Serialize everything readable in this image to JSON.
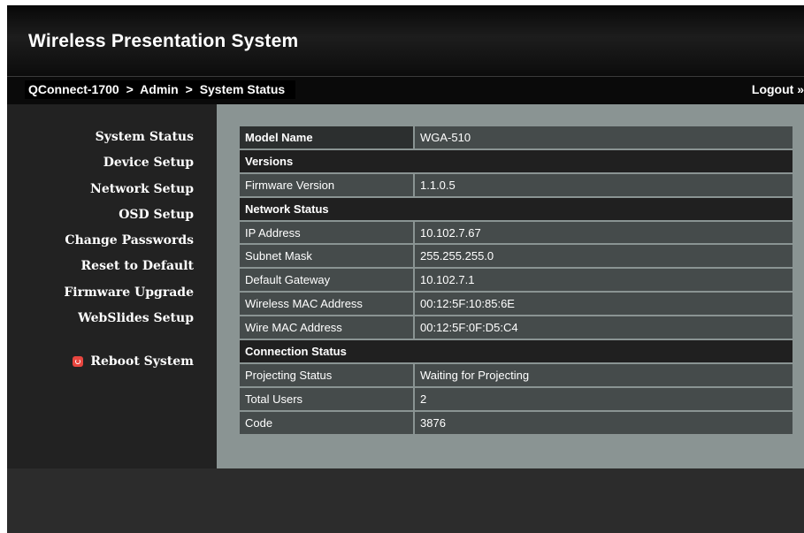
{
  "app": {
    "title": "Wireless Presentation System"
  },
  "breadcrumb": {
    "device": "QConnect-1700",
    "section": "Admin",
    "page": "System Status",
    "separator": ">"
  },
  "header": {
    "logout_label": "Logout »"
  },
  "sidebar": {
    "items": [
      {
        "label": "System Status"
      },
      {
        "label": "Device Setup"
      },
      {
        "label": "Network Setup"
      },
      {
        "label": "OSD Setup"
      },
      {
        "label": "Change Passwords"
      },
      {
        "label": "Reset to Default"
      },
      {
        "label": "Firmware Upgrade"
      },
      {
        "label": "WebSlides Setup"
      }
    ],
    "reboot_label": "Reboot System",
    "reboot_icon": "power-icon",
    "reboot_icon_color": "#e8463f"
  },
  "status": {
    "model_name": {
      "label": "Model Name",
      "value": "WGA-510"
    },
    "versions_header": "Versions",
    "firmware_version": {
      "label": "Firmware Version",
      "value": "1.1.0.5"
    },
    "network_header": "Network Status",
    "ip_address": {
      "label": "IP Address",
      "value": "10.102.7.67"
    },
    "subnet_mask": {
      "label": "Subnet Mask",
      "value": "255.255.255.0"
    },
    "default_gateway": {
      "label": "Default Gateway",
      "value": "10.102.7.1"
    },
    "wireless_mac": {
      "label": "Wireless MAC Address",
      "value": "00:12:5F:10:85:6E"
    },
    "wire_mac": {
      "label": "Wire MAC Address",
      "value": "00:12:5F:0F:D5:C4"
    },
    "connection_header": "Connection Status",
    "projecting_status": {
      "label": "Projecting Status",
      "value": "Waiting for Projecting"
    },
    "total_users": {
      "label": "Total Users",
      "value": "2"
    },
    "code": {
      "label": "Code",
      "value": "3876"
    }
  },
  "colors": {
    "header_bg": "#0c0c0c",
    "sidebar_bg": "#222222",
    "content_bg": "#8a9493",
    "row_bg": "#454b4b",
    "section_bg": "#202020"
  }
}
